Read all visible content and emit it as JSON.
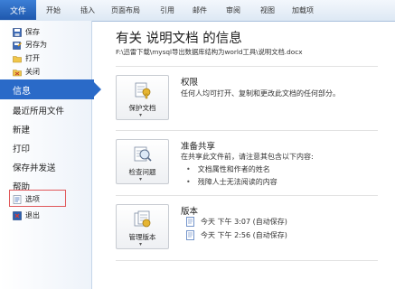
{
  "ribbon": {
    "file_tab": "文件",
    "tabs": [
      "开始",
      "插入",
      "页面布局",
      "引用",
      "邮件",
      "审阅",
      "视图",
      "加载项"
    ]
  },
  "sidebar": {
    "save": "保存",
    "save_as": "另存为",
    "open": "打开",
    "close": "关闭",
    "info": "信息",
    "recent": "最近所用文件",
    "new": "新建",
    "print": "打印",
    "save_send": "保存并发送",
    "help": "帮助",
    "options": "选项",
    "exit": "退出"
  },
  "main": {
    "title": "有关 说明文档 的信息",
    "path": "F:\\迅雷下载\\mysql导出数据库结构为world工具\\说明文档.docx",
    "permissions": {
      "button": "保护文档",
      "heading": "权限",
      "text": "任何人均可打开、复制和更改此文档的任何部分。"
    },
    "prepare": {
      "button": "检查问题",
      "heading": "准备共享",
      "text": "在共享此文件前，请注意其包含以下内容:",
      "bullets": [
        "文档属性和作者的姓名",
        "残障人士无法阅读的内容"
      ]
    },
    "versions": {
      "button": "管理版本",
      "heading": "版本",
      "items": [
        "今天 下午 3:07 (自动保存)",
        "今天 下午 2:56 (自动保存)"
      ]
    }
  },
  "colors": {
    "accent": "#2a6ac8",
    "file_tab": "#1f58ad",
    "highlight_box": "#e0575a"
  }
}
